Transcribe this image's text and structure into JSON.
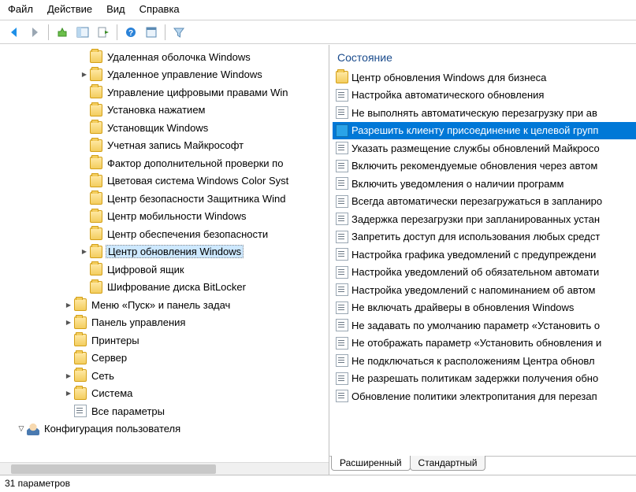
{
  "menu": {
    "file": "Файл",
    "action": "Действие",
    "view": "Вид",
    "help": "Справка"
  },
  "right_header": "Состояние",
  "status": "31 параметров",
  "tabs": {
    "extended": "Расширенный",
    "standard": "Стандартный"
  },
  "tree": [
    {
      "indent": 5,
      "exp": "",
      "icon": "folder",
      "label": "Удаленная оболочка Windows"
    },
    {
      "indent": 5,
      "exp": ">",
      "icon": "folder",
      "label": "Удаленное управление Windows"
    },
    {
      "indent": 5,
      "exp": "",
      "icon": "folder",
      "label": "Управление цифровыми правами Win"
    },
    {
      "indent": 5,
      "exp": "",
      "icon": "folder",
      "label": "Установка нажатием"
    },
    {
      "indent": 5,
      "exp": "",
      "icon": "folder",
      "label": "Установщик Windows"
    },
    {
      "indent": 5,
      "exp": "",
      "icon": "folder",
      "label": "Учетная запись Майкрософт"
    },
    {
      "indent": 5,
      "exp": "",
      "icon": "folder",
      "label": "Фактор дополнительной проверки по"
    },
    {
      "indent": 5,
      "exp": "",
      "icon": "folder",
      "label": "Цветовая система Windows Color Syst"
    },
    {
      "indent": 5,
      "exp": "",
      "icon": "folder",
      "label": "Центр безопасности Защитника Wind"
    },
    {
      "indent": 5,
      "exp": "",
      "icon": "folder",
      "label": "Центр мобильности Windows"
    },
    {
      "indent": 5,
      "exp": "",
      "icon": "folder",
      "label": "Центр обеспечения безопасности"
    },
    {
      "indent": 5,
      "exp": ">",
      "icon": "folder",
      "label": "Центр обновления Windows",
      "selected": true
    },
    {
      "indent": 5,
      "exp": "",
      "icon": "folder",
      "label": "Цифровой ящик"
    },
    {
      "indent": 5,
      "exp": "",
      "icon": "folder",
      "label": "Шифрование диска BitLocker"
    },
    {
      "indent": 4,
      "exp": ">",
      "icon": "folder",
      "label": "Меню «Пуск» и панель задач"
    },
    {
      "indent": 4,
      "exp": ">",
      "icon": "folder",
      "label": "Панель управления"
    },
    {
      "indent": 4,
      "exp": "",
      "icon": "folder",
      "label": "Принтеры"
    },
    {
      "indent": 4,
      "exp": "",
      "icon": "folder",
      "label": "Сервер"
    },
    {
      "indent": 4,
      "exp": ">",
      "icon": "folder",
      "label": "Сеть"
    },
    {
      "indent": 4,
      "exp": ">",
      "icon": "folder",
      "label": "Система"
    },
    {
      "indent": 4,
      "exp": "",
      "icon": "policy",
      "label": "Все параметры"
    },
    {
      "indent": 1,
      "exp": "v",
      "icon": "user",
      "label": "Конфигурация пользователя"
    }
  ],
  "list": [
    {
      "icon": "folder",
      "label": "Центр обновления Windows для бизнеса"
    },
    {
      "icon": "policy",
      "label": "Настройка автоматического обновления"
    },
    {
      "icon": "policy",
      "label": "Не выполнять автоматическую перезагрузку при ав"
    },
    {
      "icon": "policy-sel",
      "label": "Разрешить клиенту присоединение к целевой групп",
      "selected": true
    },
    {
      "icon": "policy",
      "label": "Указать размещение службы обновлений Майкросо"
    },
    {
      "icon": "policy",
      "label": "Включить рекомендуемые обновления через автом"
    },
    {
      "icon": "policy",
      "label": "Включить уведомления о наличии программ"
    },
    {
      "icon": "policy",
      "label": "Всегда автоматически перезагружаться в запланиро"
    },
    {
      "icon": "policy",
      "label": "Задержка перезагрузки при запланированных устан"
    },
    {
      "icon": "policy",
      "label": "Запретить доступ для использования любых средст"
    },
    {
      "icon": "policy",
      "label": "Настройка графика уведомлений с предупреждени"
    },
    {
      "icon": "policy",
      "label": "Настройка уведомлений об обязательном автомати"
    },
    {
      "icon": "policy",
      "label": "Настройка уведомлений с напоминанием об автом"
    },
    {
      "icon": "policy",
      "label": "Не включать драйверы в обновления Windows"
    },
    {
      "icon": "policy",
      "label": "Не задавать по умолчанию параметр «Установить о"
    },
    {
      "icon": "policy",
      "label": "Не отображать параметр «Установить обновления и"
    },
    {
      "icon": "policy",
      "label": "Не подключаться к расположениям Центра обновл"
    },
    {
      "icon": "policy",
      "label": "Не разрешать политикам задержки получения обно"
    },
    {
      "icon": "policy",
      "label": "Обновление политики электропитания для перезап"
    }
  ]
}
